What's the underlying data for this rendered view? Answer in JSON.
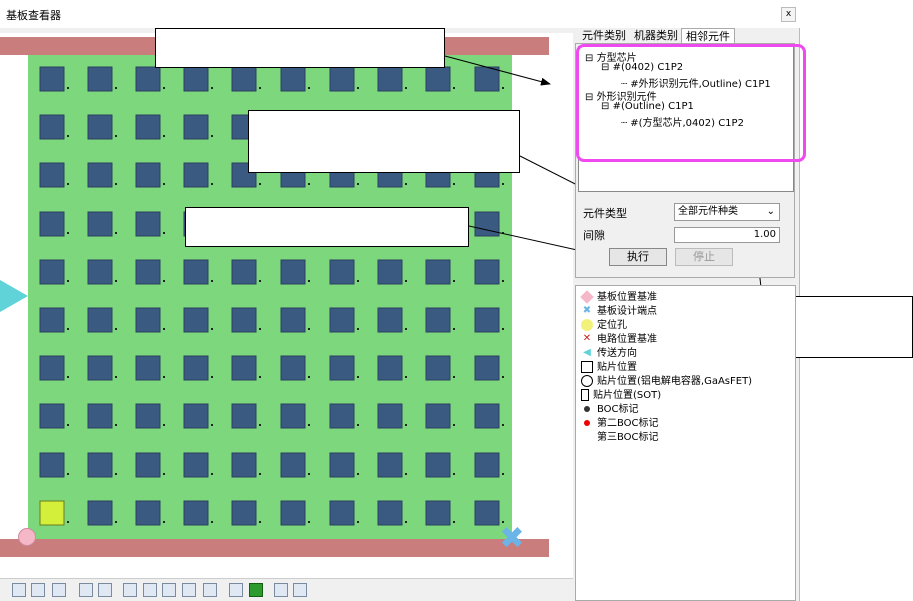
{
  "window": {
    "title": "基板查看器",
    "close_label": "x"
  },
  "tabs": [
    {
      "label": "元件类别",
      "active": false
    },
    {
      "label": "机器类别",
      "active": false
    },
    {
      "label": "相邻元件",
      "active": true
    }
  ],
  "tree": [
    {
      "label": "方型芯片",
      "toggle": "⊟"
    },
    {
      "label": "#(0402) C1P2",
      "toggle": "⊟"
    },
    {
      "label": "#外形识别元件,Outline) C1P1",
      "toggle": ""
    },
    {
      "label": "外形识别元件",
      "toggle": "⊟"
    },
    {
      "label": "#(Outline) C1P1",
      "toggle": "⊟"
    },
    {
      "label": "#(方型芯片,0402) C1P2",
      "toggle": ""
    }
  ],
  "form": {
    "type_label": "元件类型",
    "type_value": "全部元件种类",
    "gap_label": "间隙",
    "gap_value": "1.00",
    "execute_label": "执行",
    "stop_label": "停止"
  },
  "legend": [
    {
      "label": "基板位置基准",
      "icon": "pink-diamond-icon"
    },
    {
      "label": "基板设计端点",
      "icon": "blue-cross-icon"
    },
    {
      "label": "定位孔",
      "icon": "yellow-circle-icon"
    },
    {
      "label": "电路位置基准",
      "icon": "red-x-icon"
    },
    {
      "label": "传送方向",
      "icon": "cyan-arrow-icon"
    },
    {
      "label": "贴片位置",
      "icon": "square-outline-icon"
    },
    {
      "label": "贴片位置(铝电解电容器,GaAsFET)",
      "icon": "circle-outline-icon"
    },
    {
      "label": "贴片位置(SOT)",
      "icon": "sot-icon"
    },
    {
      "label": "BOC标记",
      "icon": "black-dot-icon"
    },
    {
      "label": "第二BOC标记",
      "icon": "red-dot-icon"
    },
    {
      "label": "第三BOC标记",
      "icon": ""
    }
  ],
  "colors": {
    "board": "#7dd87d",
    "rail": "#c97d7d",
    "pad": "#3a5a82",
    "highlight": "#ee4af0",
    "selected_pad": "#d4ef3a"
  },
  "toolbar_icons": [
    "image-icon",
    "grid-icon",
    "move-icon",
    "clip-icon",
    "clip-alt-icon",
    "zoom-in-icon",
    "zoom-out-icon",
    "zoom-area-icon",
    "zoom-plus-icon",
    "zoom-fit-icon",
    "chip-icon",
    "component-view-icon",
    "bucket-icon",
    "copy-icon"
  ]
}
